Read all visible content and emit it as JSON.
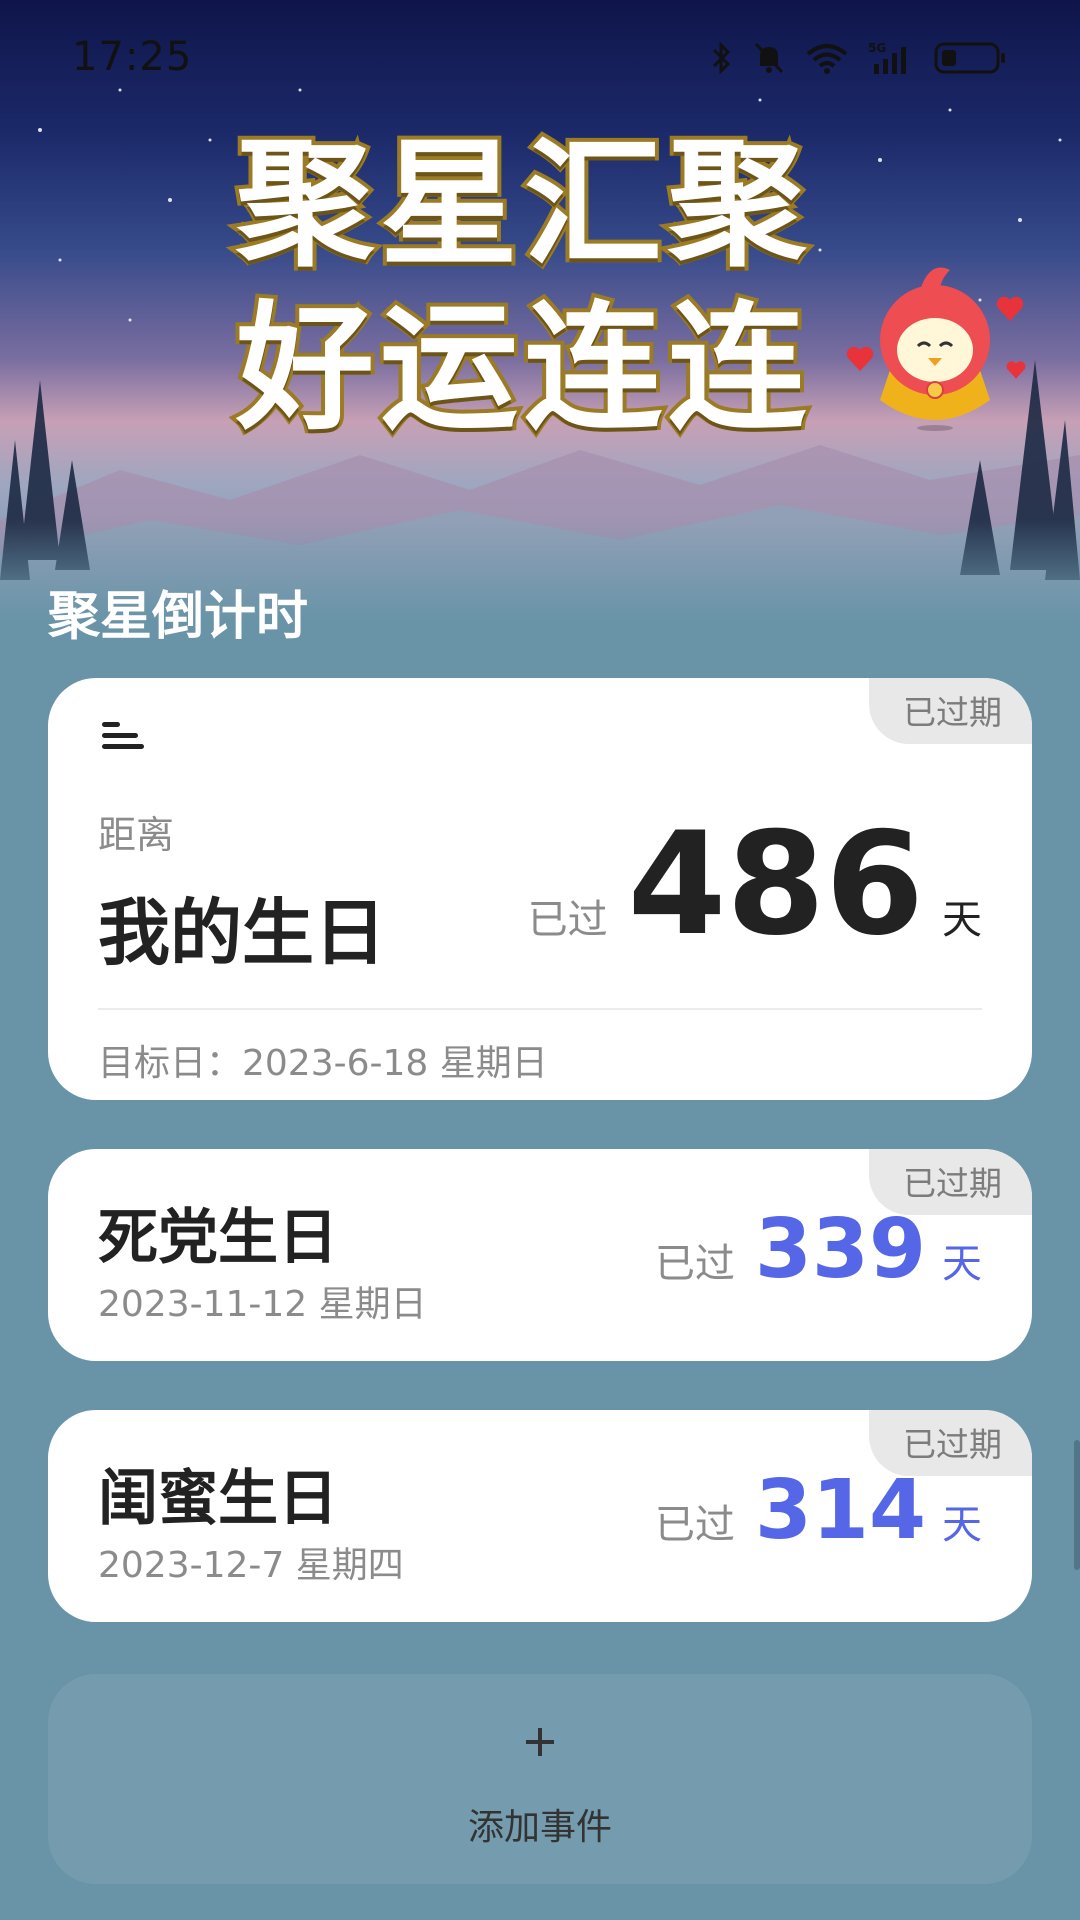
{
  "status_bar": {
    "time": "17:25"
  },
  "banner": {
    "line1": "聚星汇聚",
    "line2": "好运连连"
  },
  "section_title": "聚星倒计时",
  "main_card": {
    "badge": "已过期",
    "distance_label": "距离",
    "title": "我的生日",
    "passed_label": "已过",
    "days": "486",
    "unit": "天",
    "target_date": "目标日：2023-6-18 星期日"
  },
  "events": [
    {
      "badge": "已过期",
      "title": "死党生日",
      "date": "2023-11-12 星期日",
      "passed_label": "已过",
      "days": "339",
      "unit": "天"
    },
    {
      "badge": "已过期",
      "title": "闺蜜生日",
      "date": "2023-12-7 星期四",
      "passed_label": "已过",
      "days": "314",
      "unit": "天"
    }
  ],
  "add_event": {
    "plus": "+",
    "label": "添加事件"
  },
  "colors": {
    "accent_blue": "#5566e6",
    "background": "#6994a8"
  },
  "icons": [
    "bluetooth-icon",
    "mute-bell-icon",
    "wifi-icon",
    "signal-5g-icon",
    "battery-icon",
    "menu-icon",
    "mascot-bird-icon",
    "heart-icon",
    "plus-icon"
  ]
}
